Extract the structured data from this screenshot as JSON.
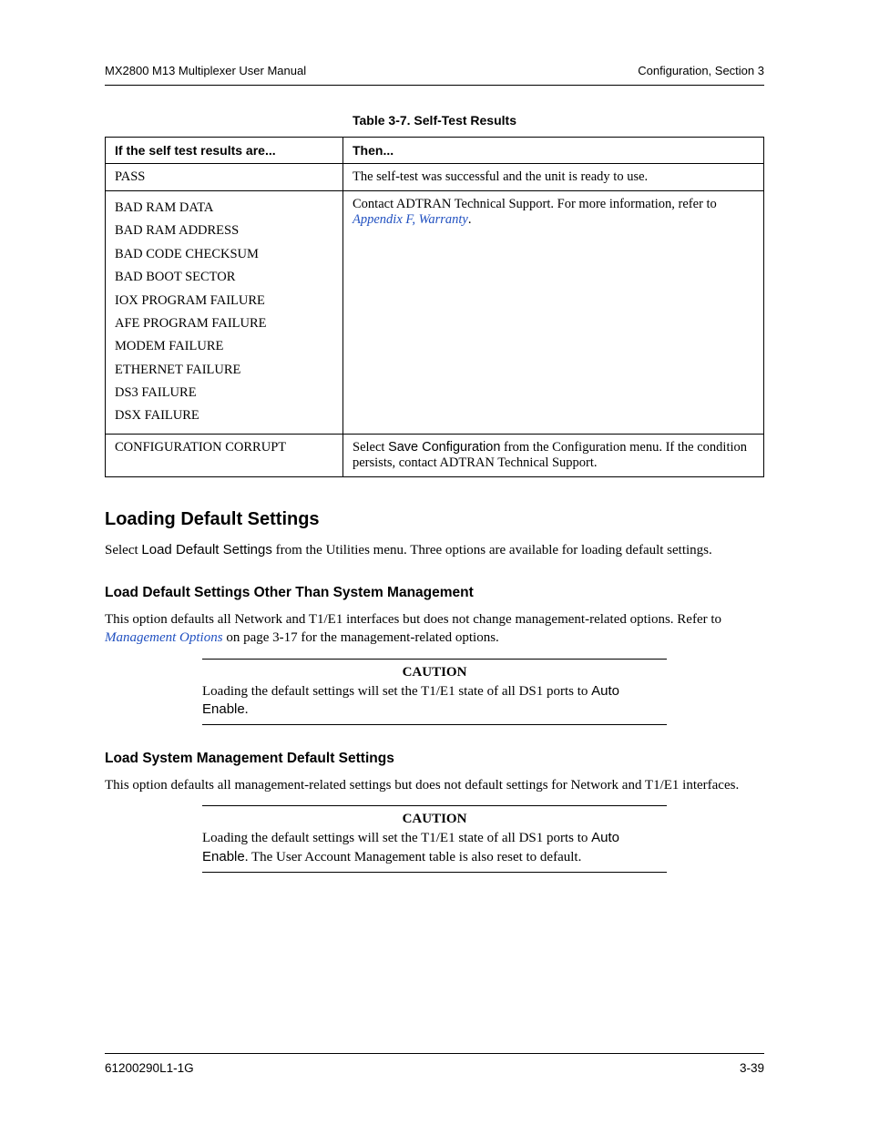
{
  "header": {
    "left": "MX2800 M13 Multiplexer User Manual",
    "right": "Configuration, Section 3"
  },
  "table": {
    "caption": "Table 3-7.  Self-Test Results",
    "head": {
      "col1": "If the self test results are...",
      "col2": "Then..."
    },
    "rows": {
      "pass": {
        "c1": "PASS",
        "c2": "The self-test was successful and the unit is ready to use."
      },
      "errors": {
        "list": [
          "BAD RAM DATA",
          "BAD RAM ADDRESS",
          "BAD CODE CHECKSUM",
          "BAD BOOT SECTOR",
          "IOX PROGRAM FAILURE",
          "AFE PROGRAM FAILURE",
          "MODEM FAILURE",
          "ETHERNET FAILURE",
          "DS3 FAILURE",
          "DSX FAILURE"
        ],
        "c2_before": "Contact ADTRAN Technical Support. For more information, refer to ",
        "c2_link": "Appendix F, Warranty",
        "c2_after": "."
      },
      "corrupt": {
        "c1": "CONFIGURATION CORRUPT",
        "c2_before": "Select ",
        "c2_sans": "Save Configuration",
        "c2_after": " from the Configuration menu. If the condition persists, contact ADTRAN Technical Support."
      }
    }
  },
  "sec1": {
    "title": "Loading Default Settings",
    "p_before": "Select ",
    "p_sans": "Load Default Settings",
    "p_after": " from the Utilities menu. Three options are available for loading default settings."
  },
  "sub1": {
    "title": "Load Default Settings Other Than System Management",
    "p_before": "This option defaults all Network and T1/E1 interfaces but does not change management-related options. Refer to ",
    "p_link": "Management Options",
    "p_after": " on page 3-17 for the management-related options."
  },
  "caution1": {
    "title": "CAUTION",
    "t1": "Loading the default settings will set the T1/E1 state of all DS1 ports to ",
    "t_sans": "Auto Enable",
    "t2": "."
  },
  "sub2": {
    "title": "Load System Management Default Settings",
    "p": "This option defaults all management-related settings but does not default settings for Network and T1/E1 interfaces."
  },
  "caution2": {
    "title": "CAUTION",
    "t1": "Loading the default settings will set the T1/E1 state of all DS1 ports to ",
    "t_sans": "Auto Enable",
    "t2": ". The User Account Management table is also reset to default."
  },
  "footer": {
    "left": "61200290L1-1G",
    "right": "3-39"
  }
}
